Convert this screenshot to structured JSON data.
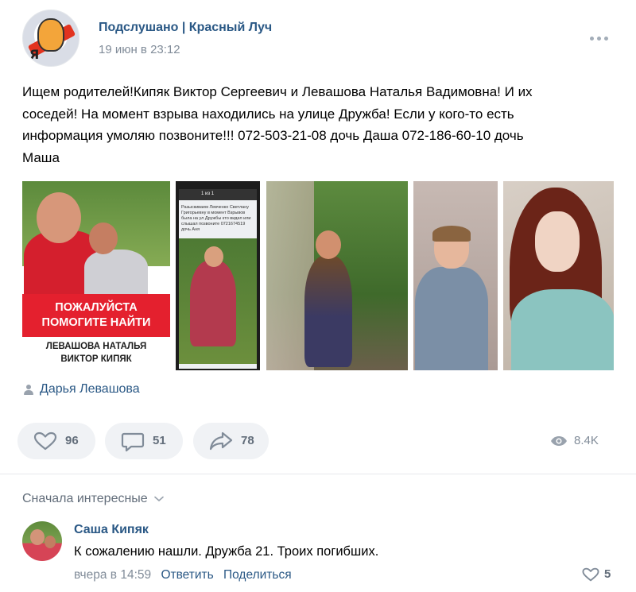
{
  "post": {
    "group_name": "Подслушано | Красный Луч",
    "date": "19 июн в 23:12",
    "text": "Ищем родителей!Кипяк Виктор Сергеевич и Левашова Наталья Вадимовна! И их\nсоседей! На момент взрыва находились на улице Дружба! Если у кого-то есть\nинформация умоляю позвоните!!! 072-503-21-08 дочь Даша 072-186-60-10 дочь\nМаша",
    "photo1": {
      "banner_line1": "Пожалуйста",
      "banner_line2": "помогите найти",
      "caption_line1": "Левашова Наталья",
      "caption_line2": "Виктор Кипяк"
    },
    "photo2": {
      "screen_title": "1 из 1",
      "screen_text": "Разыскиваем Левченко Светлану Григорьевну в момент Взрывов была на ул Дружбы кто видел или слышал позвоните 0721674519 дочь Аня"
    },
    "author_name": "Дарья Левашова",
    "likes": "96",
    "comments": "51",
    "shares": "78",
    "views": "8.4K"
  },
  "comments_section": {
    "sort_label": "Сначала интересные"
  },
  "comment": {
    "author": "Саша Кипяк",
    "text": "К сожалению нашли. Дружба 21. Троих погибших.",
    "date": "вчера в 14:59",
    "reply_label": "Ответить",
    "share_label": "Поделиться",
    "likes": "5"
  },
  "colors": {
    "link": "#2a5885",
    "muted": "#818c99",
    "button_bg": "#f0f2f5",
    "banner_red": "#e4202e"
  },
  "icons": {
    "logo": "group-logo-icon",
    "more": "more-dots-icon",
    "author": "person-icon",
    "like": "heart-icon",
    "comment": "comment-bubble-icon",
    "share": "share-arrow-icon",
    "views": "eye-icon",
    "chevron": "chevron-down-icon"
  }
}
